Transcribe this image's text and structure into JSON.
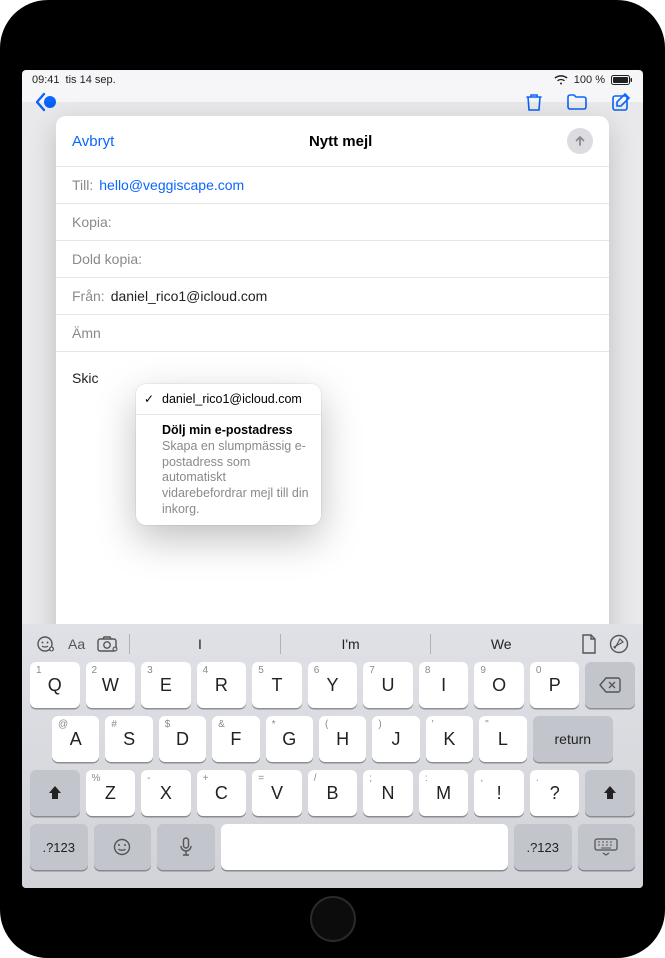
{
  "status": {
    "time": "09:41",
    "date": "tis 14 sep.",
    "battery": "100 %"
  },
  "compose": {
    "cancel": "Avbryt",
    "title": "Nytt mejl",
    "to_label": "Till:",
    "to_value": "hello@veggiscape.com",
    "cc_label": "Kopia:",
    "bcc_label": "Dold kopia:",
    "from_label": "Från:",
    "from_value": "daniel_rico1@icloud.com",
    "subject_label": "Ämn",
    "body_preview": "Skic"
  },
  "dropdown": {
    "selected": "daniel_rico1@icloud.com",
    "hide_title": "Dölj min e-postadress",
    "hide_desc": "Skapa en slumpmässig e-postadress som automatiskt vidarebefordrar mejl till din inkorg."
  },
  "keyboard": {
    "sugg1": "I",
    "sugg2": "I'm",
    "sugg3": "We",
    "return": "return",
    "numtoggle": ".?123",
    "row1": [
      {
        "k": "Q",
        "s": "1"
      },
      {
        "k": "W",
        "s": "2"
      },
      {
        "k": "E",
        "s": "3"
      },
      {
        "k": "R",
        "s": "4"
      },
      {
        "k": "T",
        "s": "5"
      },
      {
        "k": "Y",
        "s": "6"
      },
      {
        "k": "U",
        "s": "7"
      },
      {
        "k": "I",
        "s": "8"
      },
      {
        "k": "O",
        "s": "9"
      },
      {
        "k": "P",
        "s": "0"
      }
    ],
    "row2": [
      {
        "k": "A",
        "s": "@"
      },
      {
        "k": "S",
        "s": "#"
      },
      {
        "k": "D",
        "s": "$"
      },
      {
        "k": "F",
        "s": "&"
      },
      {
        "k": "G",
        "s": "*"
      },
      {
        "k": "H",
        "s": "("
      },
      {
        "k": "J",
        "s": ")"
      },
      {
        "k": "K",
        "s": "'"
      },
      {
        "k": "L",
        "s": "\""
      }
    ],
    "row3": [
      {
        "k": "Z",
        "s": "%"
      },
      {
        "k": "X",
        "s": "-"
      },
      {
        "k": "C",
        "s": "+"
      },
      {
        "k": "V",
        "s": "="
      },
      {
        "k": "B",
        "s": "/"
      },
      {
        "k": "N",
        "s": ";"
      },
      {
        "k": "M",
        "s": ":"
      },
      {
        "k": "!",
        "s": ","
      },
      {
        "k": "?",
        "s": "."
      }
    ]
  }
}
